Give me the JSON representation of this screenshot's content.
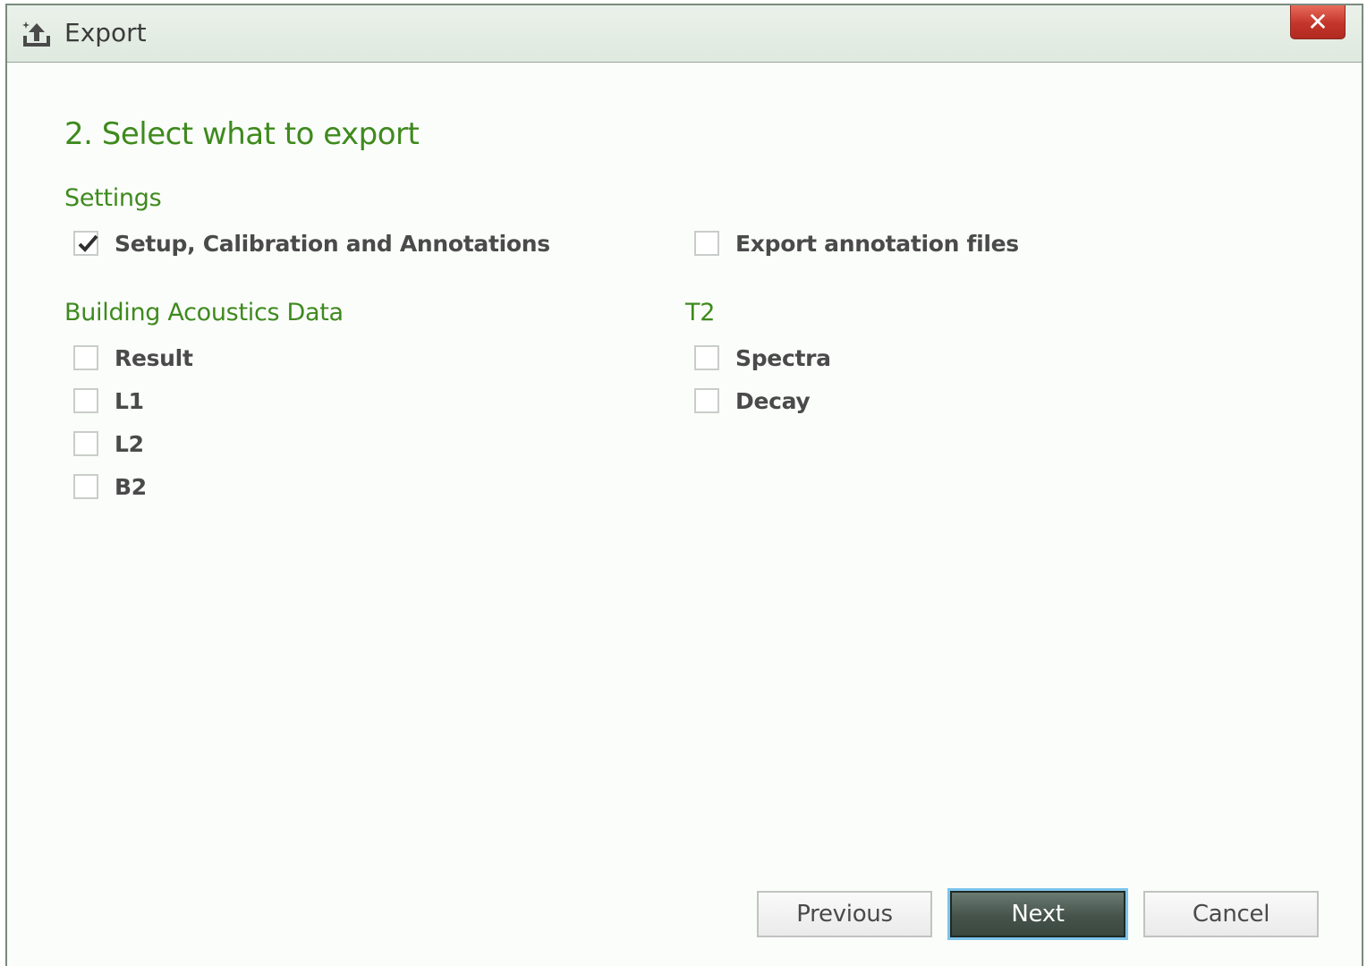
{
  "window": {
    "title": "Export",
    "close_label": "✕"
  },
  "step": {
    "heading": "2. Select what to export"
  },
  "sections": {
    "settings": {
      "label": "Settings",
      "options": [
        {
          "label": "Setup, Calibration and Annotations",
          "checked": true
        },
        {
          "label": "Export annotation files",
          "checked": false
        }
      ]
    },
    "building_acoustics": {
      "label": "Building Acoustics Data",
      "options": [
        {
          "label": "Result",
          "checked": false
        },
        {
          "label": "L1",
          "checked": false
        },
        {
          "label": "L2",
          "checked": false
        },
        {
          "label": "B2",
          "checked": false
        }
      ]
    },
    "t2": {
      "label": "T2",
      "options": [
        {
          "label": "Spectra",
          "checked": false
        },
        {
          "label": "Decay",
          "checked": false
        }
      ]
    }
  },
  "buttons": {
    "previous": "Previous",
    "next": "Next",
    "cancel": "Cancel"
  },
  "colors": {
    "accent_green": "#3f8a1e",
    "close_red": "#c3352a",
    "primary_button": "#45534b",
    "focus_ring": "#7cc4ec"
  },
  "icons": {
    "title": "export-icon",
    "close": "close-icon",
    "check": "check-mark-icon"
  }
}
